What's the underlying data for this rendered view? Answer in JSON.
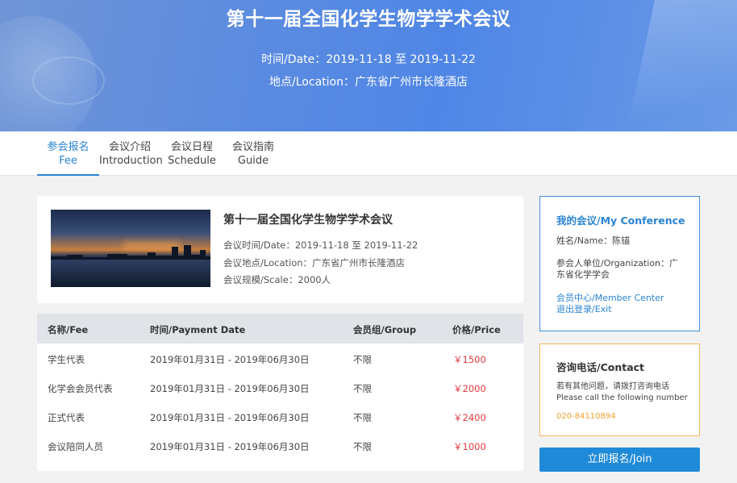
{
  "header": {
    "title": "第十一届全国化学生物学学术会议",
    "date_line": "时间/Date：2019-11-18 至 2019-11-22",
    "location_line": "地点/Location：广东省广州市长隆酒店"
  },
  "tabs": [
    {
      "cn": "参会报名",
      "en": "Fee",
      "active": true
    },
    {
      "cn": "会议介绍",
      "en": "Introduction",
      "active": false
    },
    {
      "cn": "会议日程",
      "en": "Schedule",
      "active": false
    },
    {
      "cn": "会议指南",
      "en": "Guide",
      "active": false
    }
  ],
  "conference": {
    "title": "第十一届全国化学生物学学术会议",
    "date": "会议时间/Date：2019-11-18 至 2019-11-22",
    "location": "会议地点/Location：广东省广州市长隆酒店",
    "scale": "会议规模/Scale：2000人"
  },
  "fee_table": {
    "headers": [
      "名称/Fee",
      "时间/Payment Date",
      "会员组/Group",
      "价格/Price"
    ],
    "rows": [
      {
        "name": "学生代表",
        "date": "2019年01月31日 - 2019年06月30日",
        "group": "不限",
        "price": "￥1500"
      },
      {
        "name": "化学会会员代表",
        "date": "2019年01月31日 - 2019年06月30日",
        "group": "不限",
        "price": "￥2000"
      },
      {
        "name": "正式代表",
        "date": "2019年01月31日 - 2019年06月30日",
        "group": "不限",
        "price": "￥2400"
      },
      {
        "name": "会议陪同人员",
        "date": "2019年01月31日 - 2019年06月30日",
        "group": "不限",
        "price": "￥1000"
      }
    ]
  },
  "my_conference": {
    "title": "我的会议/My Conference",
    "name": "姓名/Name：陈锚",
    "org_line1": "参会人单位/Organization：广",
    "org_line2": "东省化学学会",
    "member_center": "会员中心/Member Center",
    "logout": "退出登录/Exit"
  },
  "contact": {
    "title": "咨询电话/Contact",
    "line1": "若有其他问题，请拨打咨询电话",
    "line2": "Please call the following number",
    "phone": "020-84110894"
  },
  "join_button": "立即报名/Join",
  "colors": {
    "accent": "#2a84d3",
    "price": "#e4393c",
    "contact_border": "#f0b860",
    "phone": "#f0a030",
    "button": "#1f8ad8"
  }
}
